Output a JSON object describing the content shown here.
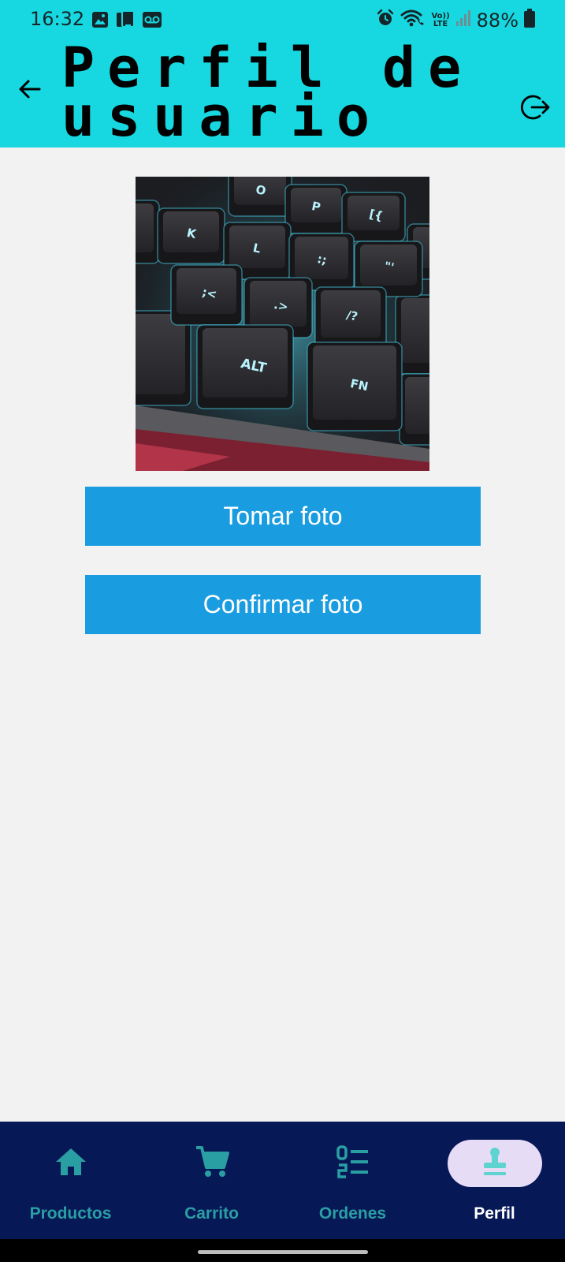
{
  "status_bar": {
    "time": "16:32",
    "battery_percent": "88%",
    "volte_label_top": "Vo))",
    "volte_label_bottom": "LTE",
    "icons": [
      "gallery-icon",
      "device-icon",
      "voicemail-icon",
      "alarm-icon",
      "wifi-calling-icon",
      "volte-icon",
      "signal-icon",
      "battery-icon"
    ]
  },
  "app_bar": {
    "title_line1": "Perfil de",
    "title_line2": "usuario",
    "back_icon": "arrow-back-icon",
    "logout_icon": "logout-icon"
  },
  "profile": {
    "photo_key_labels": [
      "O",
      "P",
      "[{",
      "K",
      "L",
      ":;",
      "\"'",
      ";<",
      ".>",
      "/?",
      "ALT",
      "FN"
    ]
  },
  "actions": {
    "take_photo_label": "Tomar foto",
    "confirm_photo_label": "Confirmar foto"
  },
  "bottom_nav": {
    "items": [
      {
        "label": "Productos",
        "icon": "home-icon",
        "active": false
      },
      {
        "label": "Carrito",
        "icon": "cart-icon",
        "active": false
      },
      {
        "label": "Ordenes",
        "icon": "list-numbered-icon",
        "active": false
      },
      {
        "label": "Perfil",
        "icon": "stamp-icon",
        "active": true
      }
    ]
  },
  "colors": {
    "app_bar": "#17d8e0",
    "background": "#f2f2f2",
    "button": "#1a9ce0",
    "nav_background": "#071857",
    "nav_inactive": "#2a9fa3",
    "nav_active_pill": "#e7dcf6",
    "nav_active_icon": "#5fd3cf"
  }
}
